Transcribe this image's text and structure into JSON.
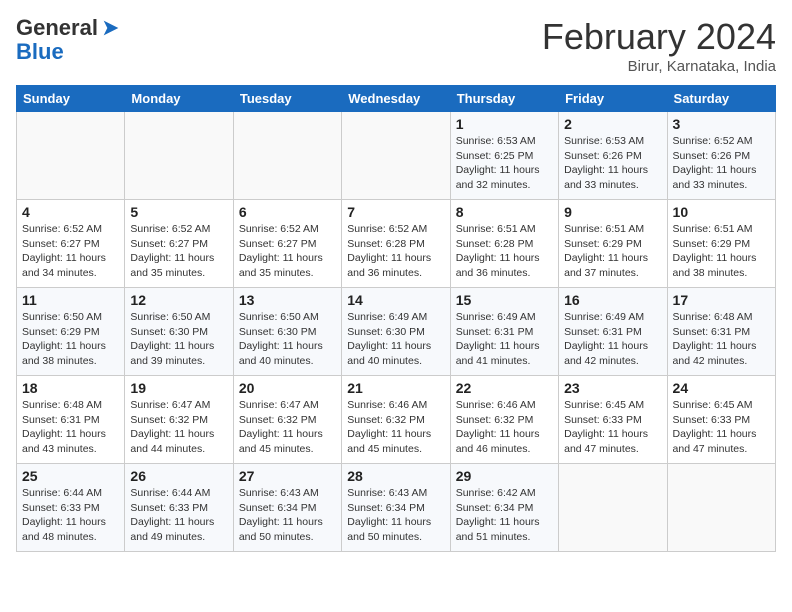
{
  "header": {
    "logo_line1": "General",
    "logo_line2": "Blue",
    "month_title": "February 2024",
    "subtitle": "Birur, Karnataka, India"
  },
  "weekdays": [
    "Sunday",
    "Monday",
    "Tuesday",
    "Wednesday",
    "Thursday",
    "Friday",
    "Saturday"
  ],
  "weeks": [
    [
      {
        "day": "",
        "info": ""
      },
      {
        "day": "",
        "info": ""
      },
      {
        "day": "",
        "info": ""
      },
      {
        "day": "",
        "info": ""
      },
      {
        "day": "1",
        "info": "Sunrise: 6:53 AM\nSunset: 6:25 PM\nDaylight: 11 hours and 32 minutes."
      },
      {
        "day": "2",
        "info": "Sunrise: 6:53 AM\nSunset: 6:26 PM\nDaylight: 11 hours and 33 minutes."
      },
      {
        "day": "3",
        "info": "Sunrise: 6:52 AM\nSunset: 6:26 PM\nDaylight: 11 hours and 33 minutes."
      }
    ],
    [
      {
        "day": "4",
        "info": "Sunrise: 6:52 AM\nSunset: 6:27 PM\nDaylight: 11 hours and 34 minutes."
      },
      {
        "day": "5",
        "info": "Sunrise: 6:52 AM\nSunset: 6:27 PM\nDaylight: 11 hours and 35 minutes."
      },
      {
        "day": "6",
        "info": "Sunrise: 6:52 AM\nSunset: 6:27 PM\nDaylight: 11 hours and 35 minutes."
      },
      {
        "day": "7",
        "info": "Sunrise: 6:52 AM\nSunset: 6:28 PM\nDaylight: 11 hours and 36 minutes."
      },
      {
        "day": "8",
        "info": "Sunrise: 6:51 AM\nSunset: 6:28 PM\nDaylight: 11 hours and 36 minutes."
      },
      {
        "day": "9",
        "info": "Sunrise: 6:51 AM\nSunset: 6:29 PM\nDaylight: 11 hours and 37 minutes."
      },
      {
        "day": "10",
        "info": "Sunrise: 6:51 AM\nSunset: 6:29 PM\nDaylight: 11 hours and 38 minutes."
      }
    ],
    [
      {
        "day": "11",
        "info": "Sunrise: 6:50 AM\nSunset: 6:29 PM\nDaylight: 11 hours and 38 minutes."
      },
      {
        "day": "12",
        "info": "Sunrise: 6:50 AM\nSunset: 6:30 PM\nDaylight: 11 hours and 39 minutes."
      },
      {
        "day": "13",
        "info": "Sunrise: 6:50 AM\nSunset: 6:30 PM\nDaylight: 11 hours and 40 minutes."
      },
      {
        "day": "14",
        "info": "Sunrise: 6:49 AM\nSunset: 6:30 PM\nDaylight: 11 hours and 40 minutes."
      },
      {
        "day": "15",
        "info": "Sunrise: 6:49 AM\nSunset: 6:31 PM\nDaylight: 11 hours and 41 minutes."
      },
      {
        "day": "16",
        "info": "Sunrise: 6:49 AM\nSunset: 6:31 PM\nDaylight: 11 hours and 42 minutes."
      },
      {
        "day": "17",
        "info": "Sunrise: 6:48 AM\nSunset: 6:31 PM\nDaylight: 11 hours and 42 minutes."
      }
    ],
    [
      {
        "day": "18",
        "info": "Sunrise: 6:48 AM\nSunset: 6:31 PM\nDaylight: 11 hours and 43 minutes."
      },
      {
        "day": "19",
        "info": "Sunrise: 6:47 AM\nSunset: 6:32 PM\nDaylight: 11 hours and 44 minutes."
      },
      {
        "day": "20",
        "info": "Sunrise: 6:47 AM\nSunset: 6:32 PM\nDaylight: 11 hours and 45 minutes."
      },
      {
        "day": "21",
        "info": "Sunrise: 6:46 AM\nSunset: 6:32 PM\nDaylight: 11 hours and 45 minutes."
      },
      {
        "day": "22",
        "info": "Sunrise: 6:46 AM\nSunset: 6:32 PM\nDaylight: 11 hours and 46 minutes."
      },
      {
        "day": "23",
        "info": "Sunrise: 6:45 AM\nSunset: 6:33 PM\nDaylight: 11 hours and 47 minutes."
      },
      {
        "day": "24",
        "info": "Sunrise: 6:45 AM\nSunset: 6:33 PM\nDaylight: 11 hours and 47 minutes."
      }
    ],
    [
      {
        "day": "25",
        "info": "Sunrise: 6:44 AM\nSunset: 6:33 PM\nDaylight: 11 hours and 48 minutes."
      },
      {
        "day": "26",
        "info": "Sunrise: 6:44 AM\nSunset: 6:33 PM\nDaylight: 11 hours and 49 minutes."
      },
      {
        "day": "27",
        "info": "Sunrise: 6:43 AM\nSunset: 6:34 PM\nDaylight: 11 hours and 50 minutes."
      },
      {
        "day": "28",
        "info": "Sunrise: 6:43 AM\nSunset: 6:34 PM\nDaylight: 11 hours and 50 minutes."
      },
      {
        "day": "29",
        "info": "Sunrise: 6:42 AM\nSunset: 6:34 PM\nDaylight: 11 hours and 51 minutes."
      },
      {
        "day": "",
        "info": ""
      },
      {
        "day": "",
        "info": ""
      }
    ]
  ]
}
